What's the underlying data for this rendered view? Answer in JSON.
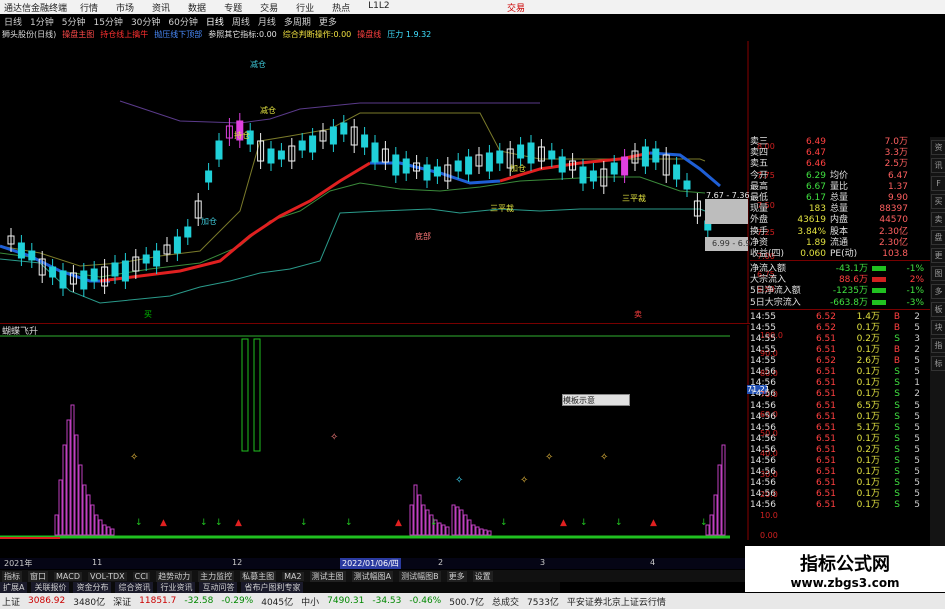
{
  "titlebar": {
    "app_title": "通达信金融终端",
    "menus": [
      "行情",
      "市场",
      "资讯",
      "数据",
      "专题",
      "交易",
      "行业",
      "热点",
      "L1L2"
    ],
    "right_label": "交易"
  },
  "periods": [
    "日线",
    "1分钟",
    "5分钟",
    "15分钟",
    "30分钟",
    "60分钟",
    "日线",
    "周线",
    "月线",
    "多周期",
    "更多"
  ],
  "indicator_bar": {
    "stock": "狮头股份(日线)",
    "items": [
      "操盘主图",
      "持仓线上擒牛",
      "抛压线下顶部",
      "参照其它指标:0.00",
      "综合判断操作:0.00",
      "操盘线",
      "压力 1.9.32"
    ]
  },
  "main_axis": [
    "8.00",
    "7.75",
    "7.50",
    "7.25",
    "7.00",
    "6.75",
    "6.50"
  ],
  "price_tags": [
    "7.67 - 7.36",
    "6.99 - 6.9"
  ],
  "chart_labels": {
    "tag_a": "减仓",
    "tag_b": "减仓",
    "tag_c": "加仓",
    "tag_d": "三平裁",
    "tag_e": "加仓",
    "tag_f": "三平裁",
    "buy": "买",
    "sell": "卖",
    "hold": "持仓",
    "bottom": "底部"
  },
  "sub_title": "蝴蝶飞升",
  "sub_axis": [
    "100.0",
    "90.0",
    "80.0",
    "70.0",
    "60.0",
    "50.0",
    "40.0",
    "30.0",
    "20.0",
    "10.0",
    "0.00"
  ],
  "sub_value": "71.21",
  "popup": "模板示意",
  "date_strip": {
    "a": "2021年",
    "b": "11",
    "c": "12",
    "d": "2022/01/06/四",
    "e": "2",
    "f": "3",
    "g": "4"
  },
  "quote_panel": [
    {
      "k": "卖三",
      "p": "6.49",
      "v": "7.0万"
    },
    {
      "k": "卖四",
      "p": "6.47",
      "v": "3.3万"
    },
    {
      "k": "卖五",
      "p": "6.46",
      "v": "2.5万"
    },
    {
      "k": "今开",
      "p": "6.29",
      "k2": "均价",
      "v": "6.47"
    },
    {
      "k": "最高",
      "p": "6.67",
      "k2": "量比",
      "v": "1.37"
    },
    {
      "k": "最低",
      "p": "6.17",
      "k2": "总量",
      "v": "9.90"
    },
    {
      "k": "现量",
      "p": "183",
      "k2": "总量",
      "v": "88397"
    },
    {
      "k": "外盘",
      "p": "43619",
      "k2": "内盘",
      "v": "44570"
    },
    {
      "k": "换手",
      "p": "3.84%",
      "k2": "股本",
      "v": "2.30亿"
    },
    {
      "k": "净资",
      "p": "1.89",
      "k2": "流通",
      "v": "2.30亿"
    },
    {
      "k": "收益(四)",
      "p": "0.060",
      "k2": "PE(动)",
      "v": "103.8"
    }
  ],
  "flow_panel": [
    {
      "k": "净流入额",
      "v": "-43.1万",
      "pct": "-1%"
    },
    {
      "k": "大宗流入",
      "v": "88.6万",
      "pct": "2%"
    },
    {
      "k": "5日净流入额",
      "v": "-1235万",
      "pct": "-1%"
    },
    {
      "k": "5日大宗流入",
      "v": "-663.8万",
      "pct": "-3%"
    }
  ],
  "trades": [
    {
      "t": "14:55",
      "p": "6.52",
      "v": "1.4万",
      "s": "B",
      "n": "2"
    },
    {
      "t": "14:55",
      "p": "6.52",
      "v": "0.1万",
      "s": "B",
      "n": "5"
    },
    {
      "t": "14:55",
      "p": "6.51",
      "v": "0.2万",
      "s": "S",
      "n": "3"
    },
    {
      "t": "14:55",
      "p": "6.51",
      "v": "0.1万",
      "s": "B",
      "n": "2"
    },
    {
      "t": "14:55",
      "p": "6.52",
      "v": "2.6万",
      "s": "B",
      "n": "5"
    },
    {
      "t": "14:56",
      "p": "6.51",
      "v": "0.1万",
      "s": "S",
      "n": "5"
    },
    {
      "t": "14:56",
      "p": "6.51",
      "v": "0.1万",
      "s": "S",
      "n": "1"
    },
    {
      "t": "14:56",
      "p": "6.51",
      "v": "0.1万",
      "s": "S",
      "n": "2"
    },
    {
      "t": "14:56",
      "p": "6.51",
      "v": "6.5万",
      "s": "S",
      "n": "5"
    },
    {
      "t": "14:56",
      "p": "6.51",
      "v": "0.1万",
      "s": "S",
      "n": "5"
    },
    {
      "t": "14:56",
      "p": "6.51",
      "v": "5.1万",
      "s": "S",
      "n": "5"
    },
    {
      "t": "14:56",
      "p": "6.51",
      "v": "0.1万",
      "s": "S",
      "n": "5"
    },
    {
      "t": "14:56",
      "p": "6.51",
      "v": "0.2万",
      "s": "S",
      "n": "5"
    },
    {
      "t": "14:56",
      "p": "6.51",
      "v": "0.1万",
      "s": "S",
      "n": "5"
    },
    {
      "t": "14:56",
      "p": "6.51",
      "v": "0.1万",
      "s": "S",
      "n": "5"
    },
    {
      "t": "14:56",
      "p": "6.51",
      "v": "0.1万",
      "s": "S",
      "n": "5"
    },
    {
      "t": "14:56",
      "p": "6.51",
      "v": "0.1万",
      "s": "S",
      "n": "5"
    },
    {
      "t": "14:56",
      "p": "6.51",
      "v": "0.1万",
      "s": "S",
      "n": "5"
    }
  ],
  "bottom_tabs": [
    "指标",
    "窗口",
    "MACD",
    "VOL-TDX",
    "CCI",
    "趋势动力",
    "主力监控",
    "私募主图",
    "MA2",
    "测试主图",
    "测试幅图A",
    "测试幅图B",
    "更多",
    "设置"
  ],
  "sub_tabs": [
    "扩展A",
    "关联报价",
    "资金分布",
    "综合资讯",
    "行业资讯",
    "互动问答",
    "省布户图利专家"
  ],
  "status": [
    {
      "k": "上证",
      "v": "3086.92",
      "c": "#c00"
    },
    {
      "k": "",
      "v": "3480亿",
      "c": "#222"
    },
    {
      "k": "深证",
      "v": "11851.7",
      "c": "#c00"
    },
    {
      "k": "",
      "v": "-32.58",
      "c": "#080"
    },
    {
      "k": "",
      "v": "-0.29%",
      "c": "#080"
    },
    {
      "k": "",
      "v": "4045亿",
      "c": "#222"
    },
    {
      "k": "中小",
      "v": "7490.31",
      "c": "#080"
    },
    {
      "k": "",
      "v": "-34.53",
      "c": "#080"
    },
    {
      "k": "",
      "v": "-0.46%",
      "c": "#080"
    },
    {
      "k": "",
      "v": "500.7亿",
      "c": "#222"
    },
    {
      "k": "总成交",
      "v": "7533亿",
      "c": "#222"
    },
    {
      "k": "",
      "v": "平安证券北京上证云行情",
      "c": "#222"
    }
  ],
  "watermark": {
    "line1": "指标公式网",
    "line2": "www.zbgs3.com"
  },
  "side_tabs": [
    "资",
    "讯",
    "F",
    "买",
    "卖",
    "盘",
    "更",
    "图",
    "多",
    "板",
    "块",
    "指",
    "标"
  ]
}
